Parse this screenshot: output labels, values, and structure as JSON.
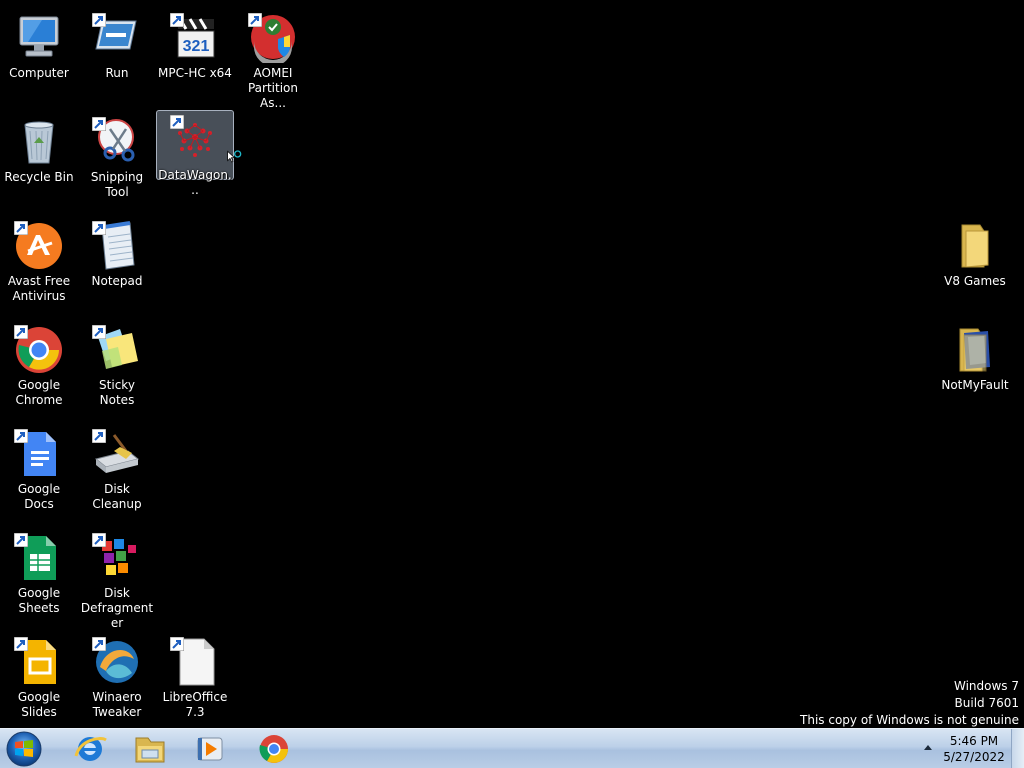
{
  "desktop": {
    "icons": [
      {
        "label": "Computer",
        "icon": "computer-icon",
        "shortcut": false
      },
      {
        "label": "Run",
        "icon": "run-icon",
        "shortcut": true
      },
      {
        "label": "MPC-HC x64",
        "icon": "mpc-hc-icon",
        "shortcut": true
      },
      {
        "label": "AOMEI Partition As...",
        "icon": "aomei-icon",
        "shortcut": true
      },
      {
        "label": "Recycle Bin",
        "icon": "recycle-bin-icon",
        "shortcut": false
      },
      {
        "label": "Snipping Tool",
        "icon": "snipping-tool-icon",
        "shortcut": true
      },
      {
        "label": "DataWagon...",
        "icon": "datawagon-icon",
        "shortcut": true,
        "selected": true
      },
      {
        "label": "Avast Free Antivirus",
        "icon": "avast-icon",
        "shortcut": true
      },
      {
        "label": "Notepad",
        "icon": "notepad-icon",
        "shortcut": true
      },
      {
        "label": "Google Chrome",
        "icon": "chrome-icon",
        "shortcut": true
      },
      {
        "label": "Sticky Notes",
        "icon": "sticky-notes-icon",
        "shortcut": true
      },
      {
        "label": "Google Docs",
        "icon": "google-docs-icon",
        "shortcut": true
      },
      {
        "label": "Disk Cleanup",
        "icon": "disk-cleanup-icon",
        "shortcut": true
      },
      {
        "label": "Google Sheets",
        "icon": "google-sheets-icon",
        "shortcut": true
      },
      {
        "label": "Disk Defragmenter",
        "icon": "disk-defragmenter-icon",
        "shortcut": true
      },
      {
        "label": "Google Slides",
        "icon": "google-slides-icon",
        "shortcut": true
      },
      {
        "label": "Winaero Tweaker",
        "icon": "winaero-icon",
        "shortcut": true
      },
      {
        "label": "LibreOffice 7.3",
        "icon": "libreoffice-icon",
        "shortcut": true
      },
      {
        "label": "V8 Games",
        "icon": "folder-icon",
        "shortcut": false
      },
      {
        "label": "NotMyFault",
        "icon": "folder-icon",
        "shortcut": false
      }
    ]
  },
  "watermark": {
    "line1": "Windows 7",
    "line2": "Build 7601",
    "line3": "This copy of Windows is not genuine"
  },
  "taskbar": {
    "pinned": [
      "internet-explorer-icon",
      "windows-explorer-icon",
      "media-player-icon",
      "chrome-icon"
    ],
    "clock_time": "5:46 PM",
    "clock_date": "5/27/2022"
  },
  "colors": {
    "desktop_background": "#000000",
    "taskbar_top": "#d8e5f3",
    "taskbar_bottom": "#a9c1df"
  }
}
